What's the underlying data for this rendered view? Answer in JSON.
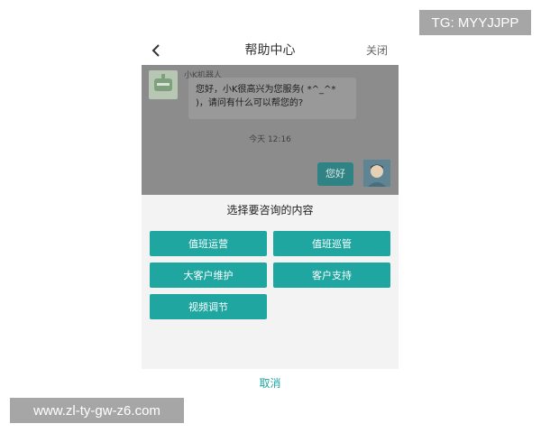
{
  "overlay": {
    "tg_label": "TG: MYYJJPP",
    "url_label": "www.zl-ty-gw-z6.com"
  },
  "nav": {
    "back_icon": "chevron-left-icon",
    "title": "帮助中心",
    "close_label": "关闭"
  },
  "chat": {
    "bot_name": "小K机器人",
    "bot_message": "您好，小K很高兴为您服务( *^_^* )，请问有什么可以帮您的?",
    "time": "今天 12:16",
    "user_message": "您好"
  },
  "panel": {
    "title": "选择要咨询的内容",
    "options": [
      "值班运营",
      "值班巡管",
      "大客户维护",
      "客户支持",
      "视频调节"
    ],
    "cancel_label": "取消"
  },
  "colors": {
    "accent": "#1fa6a0",
    "chat_overlay": "#8c8c8c",
    "badge": "#a6a6a6"
  }
}
